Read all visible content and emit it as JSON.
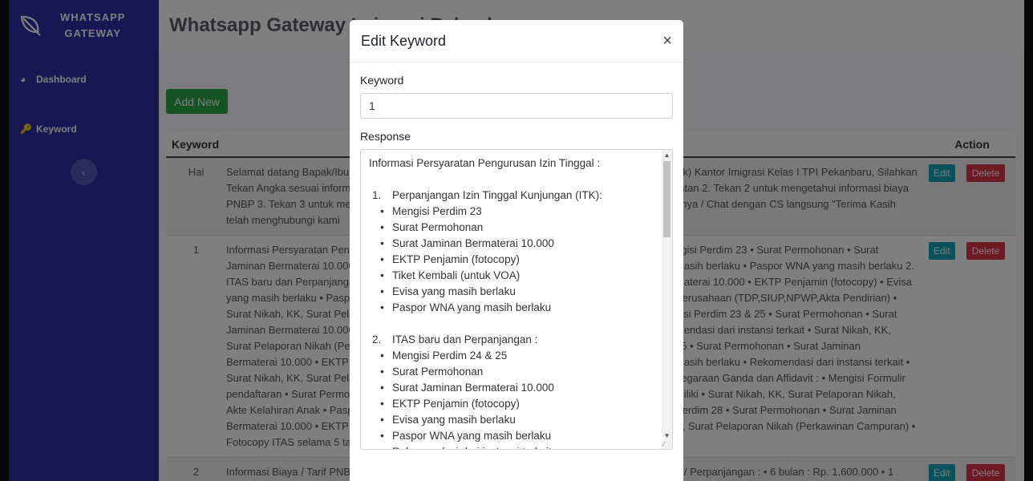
{
  "sidebar": {
    "brand_line1": "WHATSAPP",
    "brand_line2": "GATEWAY",
    "items": [
      {
        "label": "Dashboard",
        "icon": "dashboard-icon"
      },
      {
        "label": "Keyword",
        "icon": "key-icon"
      }
    ],
    "toggle_icon": "chevron-left-icon"
  },
  "header": {
    "title": "Whatsapp Gateway Imigrasi Pekanbaru"
  },
  "main": {
    "add_label": "Add New",
    "table": {
      "columns": [
        "Keyword",
        "Action"
      ],
      "rows": [
        {
          "keyword": "Hai",
          "response_left": "Selamat datang Bapak/Ibu di Layanan Whatsapp Gateway",
          "response_right": "zik) Kantor Imigrasi Kelas I TPI Pekanbaru, Silahkan",
          "lines": [
            "Selamat datang Bapak/Ibu",
            "Tekan Angka sesuai inform",
            "PNBP 3. Tekan 3 untuk me",
            "telah menghubungi kami"
          ],
          "lines_right": [
            "zik) Kantor Imigrasi Kelas I TPI Pekanbaru, Silahkan",
            "ratan 2. Tekan 2 untuk mengetahui informasi biaya",
            "nnya / Chat dengan CS langsung \"Terima Kasih",
            ""
          ],
          "edit": "Edit",
          "delete": "Delete"
        },
        {
          "keyword": "1",
          "lines": [
            "Informasi Persyaratan Peng",
            "Jaminan Bermaterai 10.000",
            "ITAS baru dan Perpanjanga",
            "yang masih berlaku • Pasp",
            "Surat Nikah, KK, Surat Pela",
            "Jaminan Bermaterai 10.000",
            "Surat Pelaporan Nikah (Pe",
            "Bermaterai 10.000 • EKTP",
            "Surat Nikah, KK, Surat Pela",
            "pendaftaran • Surat Permo",
            "Akte Kelahiran Anak • Pasp",
            "Bermaterai 10.000 • EKTP",
            "Fotocopy ITAS selama 5 ta"
          ],
          "lines_right": [
            "ngisi Perdim 23 • Surat Permohonan • Surat",
            "masih berlaku • Paspor WNA yang masih berlaku 2.",
            "materai 10.000 • EKTP Penjamin (fotocopy) • Evisa",
            "Perusahaan (TDP,SIUP,NPWP,Akta Pendirian) •",
            "gisi Perdim 23 & 25 • Surat Permohonan • Surat",
            "mendasi dari instansi terkait • Surat Nikah, KK,",
            "25 • Surat Permohonan • Surat Jaminan",
            "masih berlaku • Rekomendasi dari instansi terkait •",
            "negaraan Ganda dan Affidavit : • Mengisi Formulir",
            "miliki • Surat Nikah, KK, Surat Pelaporan Nikah,",
            "Perdim 28 • Surat Permohonan • Surat Jaminan",
            "K, Surat Pelaporan Nikah (Perkawinan Campuran) •",
            ""
          ],
          "edit": "Edit",
          "delete": "Delete"
        },
        {
          "keyword": "2",
          "lines": [
            "Informasi Biaya / Tarif PNB"
          ],
          "lines_right": [
            "u / Perpanjangan : • 6 bulan : Rp. 1.600.000 • 1"
          ],
          "edit": "Edit",
          "delete": "Delete"
        }
      ]
    }
  },
  "modal": {
    "title": "Edit Keyword",
    "close": "×",
    "keyword_label": "Keyword",
    "keyword_value": "1",
    "response_label": "Response",
    "response": {
      "heading": "Informasi Persyaratan Pengurusan Izin Tinggal :",
      "section1_num": "1.",
      "section1_title": "Perpanjangan Izin Tinggal Kunjungan (ITK):",
      "section1_items": [
        "Mengisi Perdim 23",
        "Surat Permohonan",
        "Surat Jaminan Bermaterai 10.000",
        "EKTP Penjamin (fotocopy)",
        "Tiket Kembali (untuk VOA)",
        "Evisa yang masih berlaku",
        "Paspor WNA yang masih berlaku"
      ],
      "section2_num": "2.",
      "section2_title": "ITAS baru dan Perpanjangan :",
      "section2_items": [
        "Mengisi Perdim 24 & 25",
        "Surat Permohonan",
        "Surat Jaminan Bermaterai 10.000",
        "EKTP Penjamin (fotocopy)",
        "Evisa yang masih berlaku",
        "Paspor WNA yang masih berlaku",
        "Rekomendasi dari instansi terkait"
      ]
    }
  }
}
